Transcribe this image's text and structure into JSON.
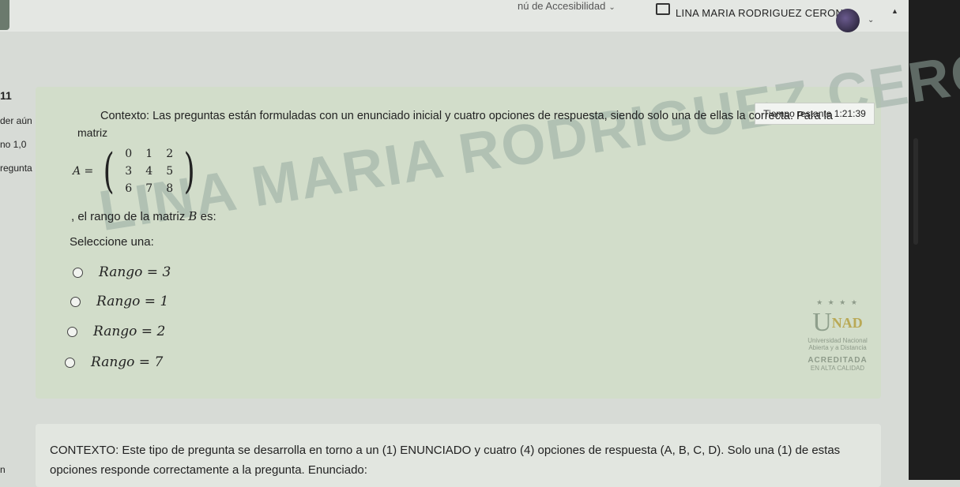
{
  "header": {
    "accessibility_menu": "nú de Accesibilidad",
    "user_name": "LINA MARIA RODRIGUEZ CERON"
  },
  "sidebar": {
    "question_number": "11",
    "status": "der aún",
    "score": "no 1,0",
    "flag": "regunta",
    "bottom_fragment": "n"
  },
  "question": {
    "timer": "Tiempo restante 1:21:39",
    "context": "Contexto: Las preguntas están formuladas con un enunciado inicial y cuatro opciones de respuesta, siendo solo una de ellas la correcta. Para la",
    "matrix_word": "matriz",
    "matrix_lhs": "A =",
    "matrix": [
      [
        "0",
        "1",
        "2"
      ],
      [
        "3",
        "4",
        "5"
      ],
      [
        "6",
        "7",
        "8"
      ]
    ],
    "rank_prefix": ", el rango de la matriz ",
    "rank_var": "B",
    "rank_suffix": " es:",
    "select_label": "Seleccione una:",
    "options": [
      {
        "label": "Rango = 3"
      },
      {
        "label": "Rango = 1"
      },
      {
        "label": "Rango = 2"
      },
      {
        "label": "Rango = 7"
      }
    ],
    "watermark": "LINA MARIA RODRIGUEZ CERON"
  },
  "logo": {
    "name_u": "U",
    "name_rest": "NAD",
    "line1": "Universidad Nacional",
    "line2": "Abierta y a Distancia",
    "accredited": "ACREDITADA",
    "quality": "EN ALTA CALIDAD"
  },
  "next_question": {
    "text": "CONTEXTO: Este tipo de pregunta se desarrolla en torno a un (1) ENUNCIADO y cuatro (4) opciones de respuesta (A, B, C, D). Solo una (1) de estas opciones responde correctamente a la pregunta. Enunciado:"
  }
}
